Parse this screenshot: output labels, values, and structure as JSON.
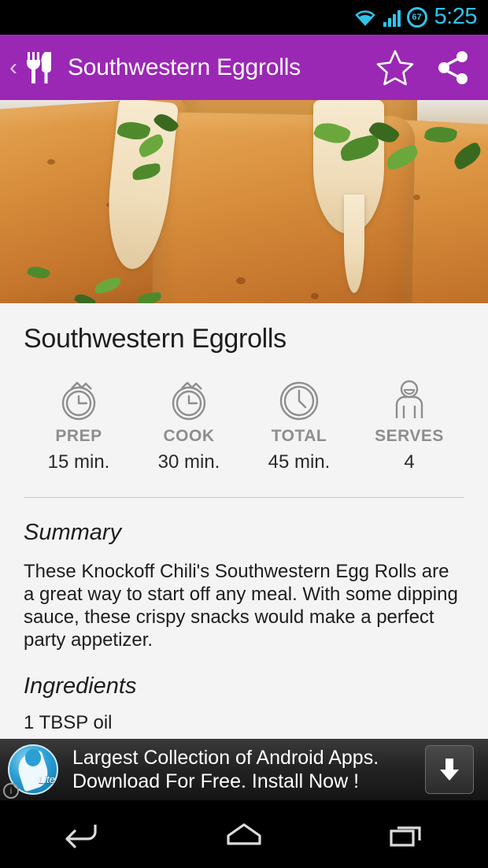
{
  "status_bar": {
    "wifi_icon": "wifi-icon",
    "signal_icon": "signal-bars-icon",
    "battery_level": "67",
    "time": "5:25",
    "accent_color": "#2ec4ec"
  },
  "app_bar": {
    "back_label": "‹",
    "app_icon": "fork-knife-icon",
    "title": "Southwestern Eggrolls",
    "favorite_icon": "star-outline-icon",
    "share_icon": "share-icon",
    "background_color": "#9b27b5"
  },
  "hero": {
    "image_alt": "southwestern-eggrolls-photo"
  },
  "recipe": {
    "title": "Southwestern Eggrolls",
    "meta": [
      {
        "icon": "stopwatch-icon",
        "label": "PREP",
        "value": "15 min."
      },
      {
        "icon": "stopwatch-icon",
        "label": "COOK",
        "value": "30 min."
      },
      {
        "icon": "clock-icon",
        "label": "TOTAL",
        "value": "45 min."
      },
      {
        "icon": "person-icon",
        "label": "SERVES",
        "value": "4"
      }
    ],
    "summary_heading": "Summary",
    "summary_text": "These Knockoff Chili's Southwestern Egg Rolls are a great way to start off any meal. With some dipping sauce, these crispy snacks would make a perfect party appetizer.",
    "ingredients_heading": "Ingredients",
    "ingredients": [
      "1 TBSP oil"
    ]
  },
  "ad": {
    "logo_icon": "app-store-lite-logo",
    "logo_badge": "Lite",
    "info_icon": "info-icon",
    "line1": "Largest Collection of Android Apps.",
    "line2": "Download For Free. Install Now !",
    "download_icon": "download-arrow-icon"
  },
  "nav_bar": {
    "back_icon": "nav-back-icon",
    "home_icon": "nav-home-icon",
    "recents_icon": "nav-recents-icon"
  }
}
